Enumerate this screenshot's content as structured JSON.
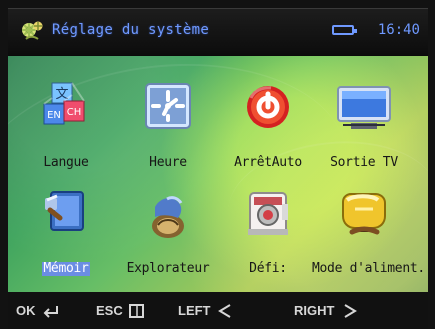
{
  "header": {
    "title": "Réglage du système",
    "time": "16:40",
    "title_icon": "system-settings-icon",
    "battery_icon": "battery-icon"
  },
  "menu": {
    "items": [
      {
        "label": "Langue",
        "icon": "language-icon"
      },
      {
        "label": "Heure",
        "icon": "clock-icon"
      },
      {
        "label": "ArrêtAuto",
        "icon": "power-off-icon"
      },
      {
        "label": "Sortie TV",
        "icon": "tv-icon"
      },
      {
        "label": "Mémoir",
        "icon": "memory-icon",
        "selected": true
      },
      {
        "label": "Explorateur",
        "icon": "explorer-icon"
      },
      {
        "label": "Défi:",
        "icon": "camera-icon"
      },
      {
        "label": "Mode d'aliment.",
        "icon": "battery-charge-icon"
      }
    ]
  },
  "footer": {
    "ok": "OK",
    "esc": "ESC",
    "left": "LEFT",
    "right": "RIGHT"
  },
  "colors": {
    "accent_text": "#6f99ff",
    "selected_bg": "#6b8de3",
    "background_green": "#41a55f"
  }
}
